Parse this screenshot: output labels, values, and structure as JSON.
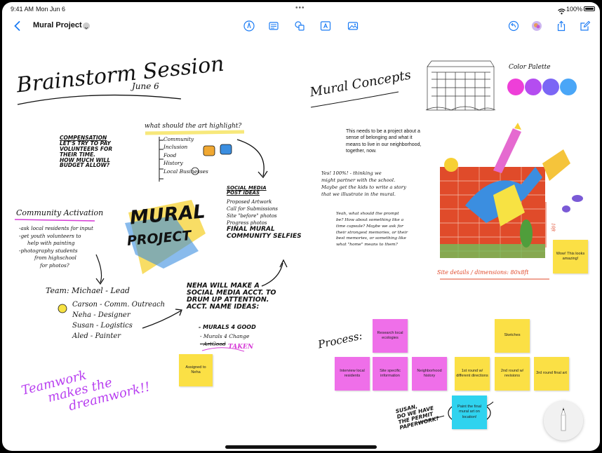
{
  "status_bar": {
    "time": "9:41 AM",
    "date": "Mon Jun 6",
    "battery": "100%"
  },
  "toolbar": {
    "doc_title": "Mural Project",
    "icons": [
      "back-chevron-icon",
      "title-chevron-icon",
      "pen-tool-icon",
      "notes-icon",
      "shapes-icon",
      "text-box-icon",
      "media-icon",
      "undo-icon",
      "collaborator-avatar-icon",
      "share-icon",
      "compose-icon"
    ]
  },
  "left": {
    "title": "Brainstorm Session",
    "date": "June 6",
    "compensation": {
      "heading": "Compensation",
      "lines": [
        "Let's try to pay",
        "volunteers for",
        "their time.",
        "How much will",
        "budget allow?"
      ]
    },
    "highlight": {
      "heading": "what should the art highlight?",
      "items": [
        "Community",
        "Inclusion",
        "Food",
        "History",
        "Local Businesses"
      ]
    },
    "social": {
      "heading1": "Social Media",
      "heading2": "Post Ideas",
      "items": [
        "Proposed Artwork",
        "Call for Submissions",
        "Site \"before\" photos",
        "Progress photos",
        "Final Mural",
        "Community Selfies"
      ]
    },
    "community": {
      "heading": "Community Activation",
      "lines": [
        "-ask local residents for input",
        "-get youth volunteers to",
        "help with painting",
        "-photography students",
        "from highschool",
        "for photos?"
      ]
    },
    "logo": {
      "line1": "MURAL",
      "line2": "PROJECT"
    },
    "team": {
      "heading": "Team: Michael - Lead",
      "members": [
        "Carson - Comm. Outreach",
        "Neha - Designer",
        "Susan - Logistics",
        "Aled - Painter"
      ]
    },
    "neha": {
      "lines": [
        "Neha will make a",
        "social media acct. to",
        "drum up attention.",
        "Acct. name ideas:"
      ],
      "ideas": [
        "- Murals 4 Good",
        "- Murals 4 Change",
        "- ArtGood"
      ],
      "taken": "TAKEN"
    },
    "sticky_assigned": "Assigned to Neha",
    "teamwork": [
      "Teamwork",
      "makes the",
      "dreamwork!!"
    ]
  },
  "right": {
    "title": "Mural Concepts",
    "palette_label": "Color Palette",
    "palette": [
      "#ee3fd8",
      "#b44df0",
      "#7b66f5",
      "#4aa6f7"
    ],
    "typed_text": "This needs to be a project about a sense of belonging and what it means to live in our neighborhood, together, now.",
    "note1": [
      "Yes! 100%! - thinking we",
      "might partner with the school.",
      "Maybe get the kids to write a story",
      "that we illustrate in the mural."
    ],
    "note2": [
      "Yeah, what should the prompt",
      "be? How about something like a",
      "time capsule? Maybe we ask for",
      "their strongest memories, or their",
      "best memories, or something like",
      "what \"home\" means to them?"
    ],
    "dims": "Site details / dimensions: 80x8ft",
    "dim_v": "10ft",
    "wow_sticky": "Wow! This looks amazing!",
    "process": "Process:",
    "stickies": {
      "research": "Research local ecologies",
      "interview": "Interview local residents",
      "site": "Site specific information",
      "history": "Neighborhood history",
      "sketches": "Sketches",
      "r1": "1st round w/ different directions",
      "r2": "2nd round w/ revisions",
      "r3": "3rd round final art",
      "paint": "Paint the final mural art on location!"
    },
    "susan": [
      "Susan,",
      "do we have",
      "the permit",
      "paperwork?"
    ]
  }
}
